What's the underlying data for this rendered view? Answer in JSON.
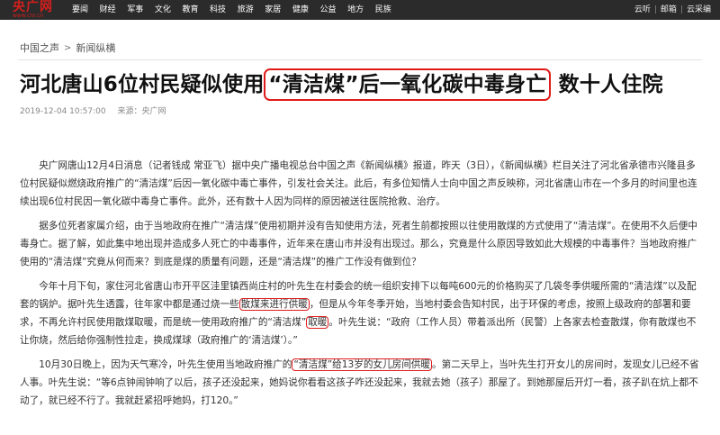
{
  "site": {
    "brand": "央广网",
    "url": "www.cnr.cn",
    "nav": [
      "要闻",
      "财经",
      "军事",
      "文化",
      "教育",
      "科技",
      "旅游",
      "家居",
      "健康",
      "公益",
      "地方",
      "民族"
    ],
    "right_links": [
      "云听",
      "邮箱",
      "云采编"
    ]
  },
  "breadcrumb": [
    "中国之声",
    "新闻纵横"
  ],
  "article": {
    "title_before": "河北唐山6位村民疑似使用",
    "title_highlight": "“清洁煤”后一氧化碳中毒身亡",
    "title_after": " 数十人住院",
    "date": "2019-12-04 10:57:00",
    "source": "来源：央广网",
    "paragraphs": [
      {
        "t1": "央广网唐山12月4日消息（记者钱成 常亚飞）据中央广播电视总台中国之声《新闻纵横》报道，昨天（3日），《新闻纵横》栏目关注了河北省承德市兴隆县多位村民疑似燃烧政府推广的“清洁煤”后因一氧化碳中毒亡事件，引发社会关注。此后，有多位知情人士向中国之声反映称，河北省唐山市在一个多月的时间里也连续出现6位村民因一氧化碳中毒身亡事件。此外，还有数十人因为同样的原因被送往医院抢救、治疗。"
      },
      {
        "t1": "据多位死者家属介绍，由于当地政府在推广“清洁煤”使用初期并没有告知使用方法，死者生前都按照以往使用散煤的方式使用了“清洁煤”。在使用不久后便中毒身亡。据了解，如此集中地出现并造成多人死亡的中毒事件，近年来在唐山市并没有出现过。那么，究竟是什么原因导致如此大规模的中毒事件？当地政府推广使用的“清洁煤”究竟从何而来？到底是煤的质量有问题，还是“清洁煤”的推广工作没有做到位？"
      },
      {
        "t1": "今年十月下旬，家住河北省唐山市开平区洼里镇西尚庄村的叶先生在村委会的统一组织安排下以每吨600元的价格购买了几袋冬季供暖所需的“清洁煤”以及配套的锅炉。据叶先生透露，往年家中都是通过烧一些",
        "box1": "散煤来进行供暖",
        "t2": "，但是从今年冬季开始，当地村委会告知村民，出于环保的考虑，按照上级政府的部署和要求，不再允许村民使用散煤取暖，而是统一使用政府推广的“清洁煤”",
        "box2": "取暖",
        "t3": "。叶先生说：“政府（工作人员）带着派出所（民警）上各家去检查散煤，你有散煤也不让你烧，然后给你强制性拉走，换成煤球（政府推广的‘清洁煤’）。”"
      },
      {
        "t1": "10月30日晚上，因为天气寒冷，叶先生使用当地政府推广的",
        "box1": "“清洁煤”给13岁的女儿房间供暖",
        "t2": "。第二天早上，当叶先生打开女儿的房间时，发现女儿已经不省人事。叶先生说：“等6点钟闹钟响了以后，孩子还没起来，她妈说你看看这孩子咋还没起来，我就去她（孩子）那屋了。到她那屋后开灯一看，孩子趴在炕上都不动了，就已经不行了。我就赶紧招呼她妈，打120。”"
      }
    ]
  }
}
